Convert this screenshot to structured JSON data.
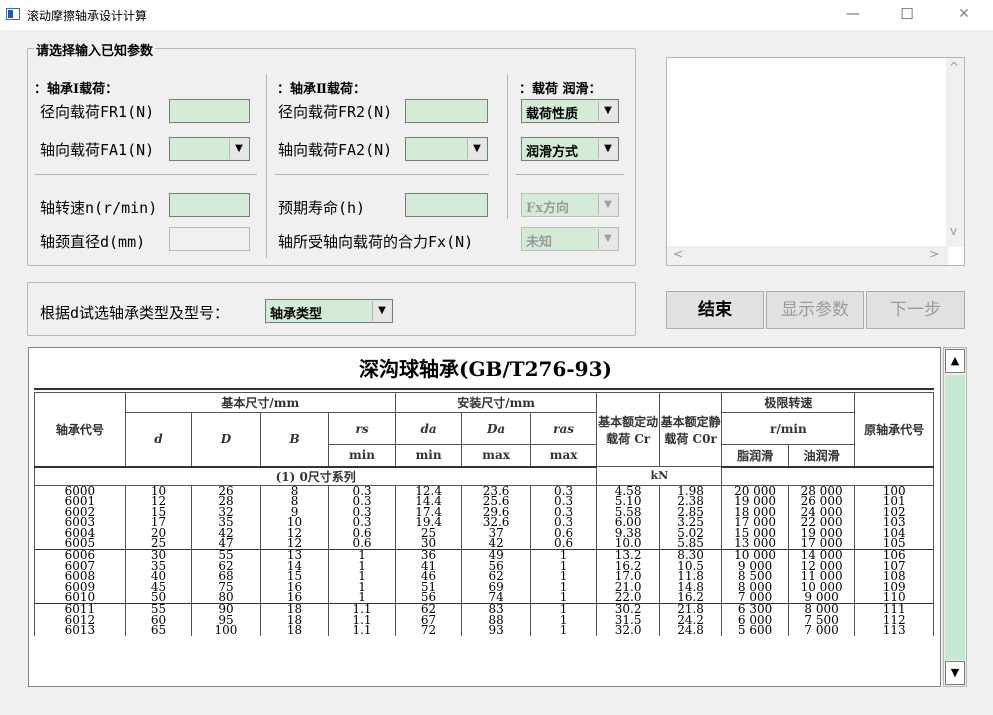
{
  "window": {
    "title": "滚动摩擦轴承设计计算",
    "minimize": "—",
    "maximize": "☐",
    "close": "✕"
  },
  "group": {
    "legend": "请选择输入已知参数",
    "col1_header": "：轴承Ⅰ载荷：",
    "col2_header": "：轴承Ⅱ载荷：",
    "col3_header": "：载荷 润滑：",
    "fr1_label": "径向载荷FR1(N)",
    "fr1_value": "",
    "fa1_label": "轴向载荷FA1(N)",
    "fa1_value": "",
    "fr2_label": "径向载荷FR2(N)",
    "fr2_value": "",
    "fa2_label": "轴向载荷FA2(N)",
    "fa2_value": "",
    "load_nature": "载荷性质",
    "lubrication": "润滑方式",
    "speed_label": "轴转速n(r/min)",
    "speed_value": "",
    "life_label": "预期寿命(h)",
    "life_value": "",
    "fx_dir": "Fx方向",
    "journal_label": "轴颈直径d(mm)",
    "journal_value": "",
    "fx_label": "轴所受轴向载荷的合力Fx(N)",
    "fx_value": "未知"
  },
  "select": {
    "label": "根据d试选轴承类型及型号：",
    "value": "轴承类型"
  },
  "buttons": {
    "end": "结束",
    "show_params": "显示参数",
    "next": "下一步"
  },
  "icons": {
    "dropdown": "▼",
    "up": "▲",
    "down": "▼",
    "scroll_up": "^",
    "scroll_down": "v",
    "scroll_left": "<",
    "scroll_right": ">"
  },
  "table": {
    "title": "深沟球轴承(GB/T276-93)",
    "h_code": "轴承代号",
    "h_basic": "基本尺寸/mm",
    "h_install": "安装尺寸/mm",
    "h_cr": "基本额定动载荷 Cr",
    "h_cor": "基本额定静载荷 C0r",
    "h_kn": "kN",
    "h_speed": "极限转速",
    "h_rmin": "r/min",
    "h_grease": "脂润滑",
    "h_oil": "油润滑",
    "h_old": "原轴承代号",
    "c_d": "d",
    "c_D": "D",
    "c_B": "B",
    "c_rs": "rs",
    "c_rs_sub": "min",
    "c_da": "da",
    "c_da_sub": "min",
    "c_Da": "Da",
    "c_Da_sub": "max",
    "c_ras": "ras",
    "c_ras_sub": "max",
    "series": "(1) 0尺寸系列",
    "groups": [
      [
        [
          "6000",
          "10",
          "26",
          "8",
          "0.3",
          "12.4",
          "23.6",
          "0.3",
          "4.58",
          "1.98",
          "20 000",
          "28 000",
          "100"
        ],
        [
          "6001",
          "12",
          "28",
          "8",
          "0.3",
          "14.4",
          "25.6",
          "0.3",
          "5.10",
          "2.38",
          "19 000",
          "26 000",
          "101"
        ],
        [
          "6002",
          "15",
          "32",
          "9",
          "0.3",
          "17.4",
          "29.6",
          "0.3",
          "5.58",
          "2.85",
          "18 000",
          "24 000",
          "102"
        ],
        [
          "6003",
          "17",
          "35",
          "10",
          "0.3",
          "19.4",
          "32.6",
          "0.3",
          "6.00",
          "3.25",
          "17 000",
          "22 000",
          "103"
        ],
        [
          "6004",
          "20",
          "42",
          "12",
          "0.6",
          "25",
          "37",
          "0.6",
          "9.38",
          "5.02",
          "15 000",
          "19 000",
          "104"
        ],
        [
          "6005",
          "25",
          "47",
          "12",
          "0.6",
          "30",
          "42",
          "0.6",
          "10.0",
          "5.85",
          "13 000",
          "17 000",
          "105"
        ]
      ],
      [
        [
          "6006",
          "30",
          "55",
          "13",
          "1",
          "36",
          "49",
          "1",
          "13.2",
          "8.30",
          "10 000",
          "14 000",
          "106"
        ],
        [
          "6007",
          "35",
          "62",
          "14",
          "1",
          "41",
          "56",
          "1",
          "16.2",
          "10.5",
          "9 000",
          "12 000",
          "107"
        ],
        [
          "6008",
          "40",
          "68",
          "15",
          "1",
          "46",
          "62",
          "1",
          "17.0",
          "11.8",
          "8 500",
          "11 000",
          "108"
        ],
        [
          "6009",
          "45",
          "75",
          "16",
          "1",
          "51",
          "69",
          "1",
          "21.0",
          "14.8",
          "8 000",
          "10 000",
          "109"
        ],
        [
          "6010",
          "50",
          "80",
          "16",
          "1",
          "56",
          "74",
          "1",
          "22.0",
          "16.2",
          "7 000",
          "9 000",
          "110"
        ]
      ],
      [
        [
          "6011",
          "55",
          "90",
          "18",
          "1.1",
          "62",
          "83",
          "1",
          "30.2",
          "21.8",
          "6 300",
          "8 000",
          "111"
        ],
        [
          "6012",
          "60",
          "95",
          "18",
          "1.1",
          "67",
          "88",
          "1",
          "31.5",
          "24.2",
          "6 000",
          "7 500",
          "112"
        ],
        [
          "6013",
          "65",
          "100",
          "18",
          "1.1",
          "72",
          "93",
          "1",
          "32.0",
          "24.8",
          "5 600",
          "7 000",
          "113"
        ]
      ]
    ]
  }
}
